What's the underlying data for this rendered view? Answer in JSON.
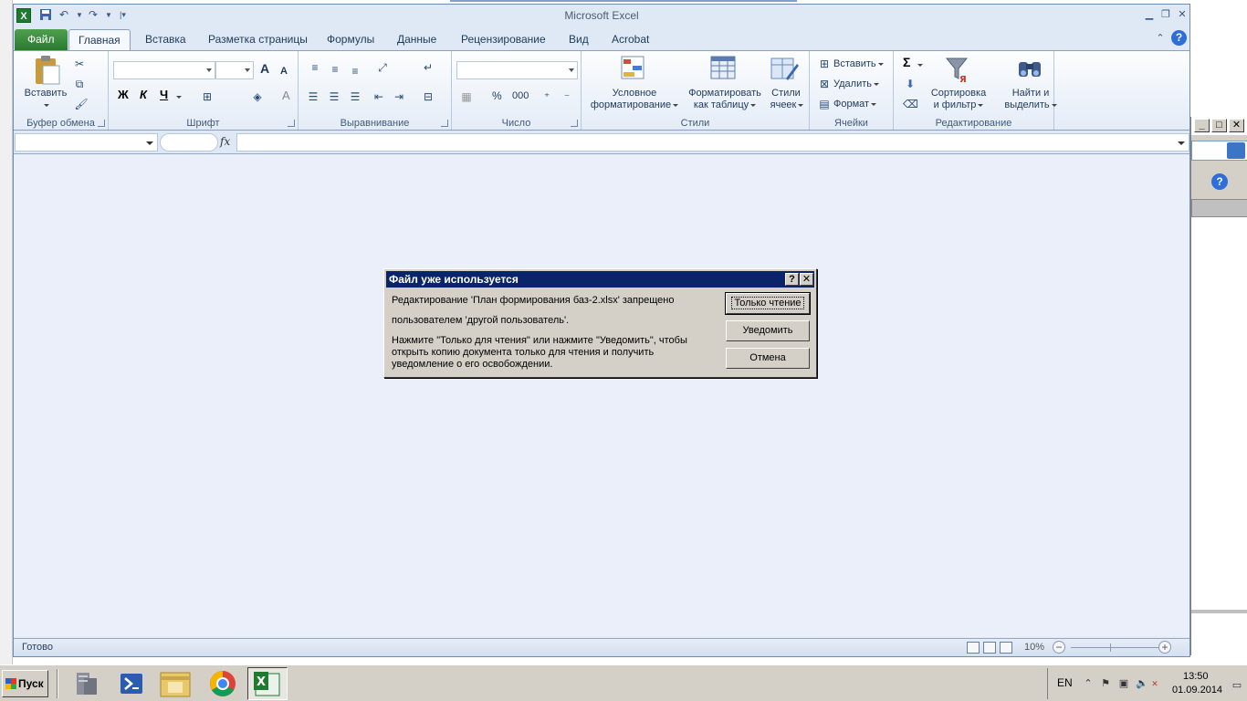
{
  "window": {
    "title": "Microsoft Excel"
  },
  "tabs": [
    {
      "label": "Файл"
    },
    {
      "label": "Главная"
    },
    {
      "label": "Вставка"
    },
    {
      "label": "Разметка страницы"
    },
    {
      "label": "Формулы"
    },
    {
      "label": "Данные"
    },
    {
      "label": "Рецензирование"
    },
    {
      "label": "Вид"
    },
    {
      "label": "Acrobat"
    }
  ],
  "ribbon": {
    "clipboard": {
      "group_label": "Буфер обмена",
      "paste_label": "Вставить"
    },
    "font": {
      "group_label": "Шрифт",
      "bold": "Ж",
      "italic": "К",
      "underline": "Ч",
      "grow": "A",
      "shrink": "A",
      "font_color": "A"
    },
    "alignment": {
      "group_label": "Выравнивание"
    },
    "number": {
      "group_label": "Число",
      "percent": "%",
      "thousands": "000"
    },
    "styles": {
      "group_label": "Стили",
      "conditional_line1": "Условное",
      "conditional_line2": "форматирование",
      "format_table_line1": "Форматировать",
      "format_table_line2": "как таблицу",
      "cell_styles_line1": "Стили",
      "cell_styles_line2": "ячеек"
    },
    "cells": {
      "group_label": "Ячейки",
      "insert": "Вставить",
      "delete": "Удалить",
      "format": "Формат"
    },
    "editing": {
      "group_label": "Редактирование",
      "sigma": "Σ",
      "sort_line1": "Сортировка",
      "sort_line2": "и фильтр",
      "find_line1": "Найти и",
      "find_line2": "выделить"
    }
  },
  "formula_bar": {
    "fx": "fx"
  },
  "status_bar": {
    "status": "Готово",
    "zoom": "10%"
  },
  "dialog": {
    "title": "Файл уже используется",
    "message_line1": "Редактирование 'План формирования баз-2.xlsx' запрещено",
    "message_line2": "пользователем 'другой пользователь'.",
    "hint_line1": "Нажмите \"Только для чтения\" или нажмите \"Уведомить\", чтобы",
    "hint_line2": "открыть копию документа только для чтения и получить",
    "hint_line3": "уведомление о его освобождении.",
    "readonly_button": "Только чтение",
    "notify_button": "Уведомить",
    "cancel_button": "Отмена",
    "help_glyph": "?",
    "close_glyph": "✕"
  },
  "taskbar": {
    "start_label": "Пуск",
    "language": "EN",
    "time": "13:50",
    "date": "01.09.2014"
  },
  "colors": {
    "dialog_title_bg": "#0a246a",
    "excel_green": "#1f7a2f",
    "file_tab_green": "#2a7a2d"
  }
}
